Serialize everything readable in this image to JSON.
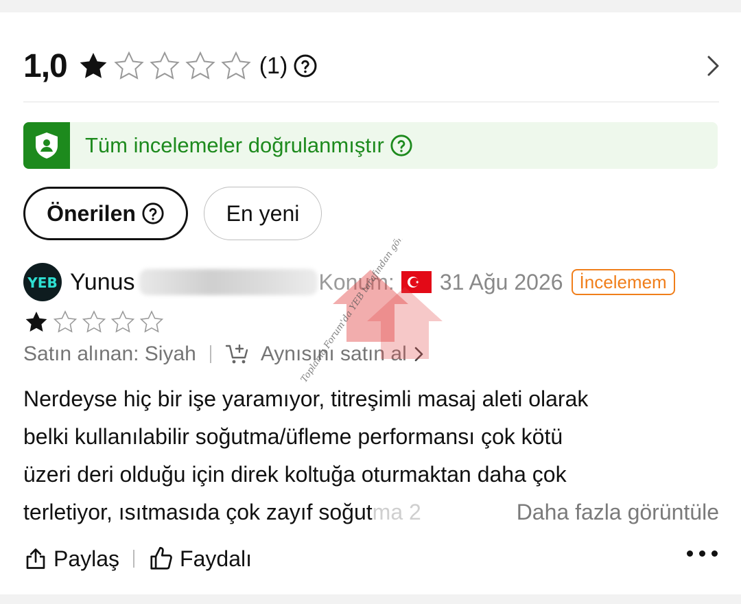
{
  "summary": {
    "score": "1,0",
    "rating_filled_stars": 1,
    "rating_total_stars": 5,
    "count": "(1)"
  },
  "verified": {
    "text": "Tüm incelemeler doğrulanmıştır"
  },
  "sort_tabs": [
    {
      "label": "Önerilen",
      "active": true
    },
    {
      "label": "En yeni",
      "active": false
    }
  ],
  "review": {
    "avatar_text": "YEB",
    "reviewer_name": "Yunus",
    "location_label": "Konum:",
    "date": "31 Ağu 2026",
    "badge": "İncelemem",
    "stars": 1,
    "purchased": "Satın alınan: Siyah",
    "buy_again": "Aynısını satın al",
    "body_lines": [
      "Nerdeyse hiç bir işe yaramıyor, titreşimli masaj aleti olarak",
      "belki kullanılabilir soğutma/üfleme performansı çok kötü",
      "üzeri deri olduğu için direk koltuğa oturmaktan daha çok",
      "terletiyor, ısıtmasıda çok zayıf soğut"
    ],
    "body_fade": "ma 2",
    "see_more": "Daha fazla görüntüle"
  },
  "actions": {
    "share": "Paylaş",
    "helpful": "Faydalı"
  },
  "watermark_text": "Toplama Forum'da YEB tarafından gönderildi",
  "colors": {
    "verified_green": "#1d8a1d",
    "verified_bg": "#eef8ec",
    "badge_orange": "#f07e1a",
    "flag_red": "#e30a17"
  }
}
